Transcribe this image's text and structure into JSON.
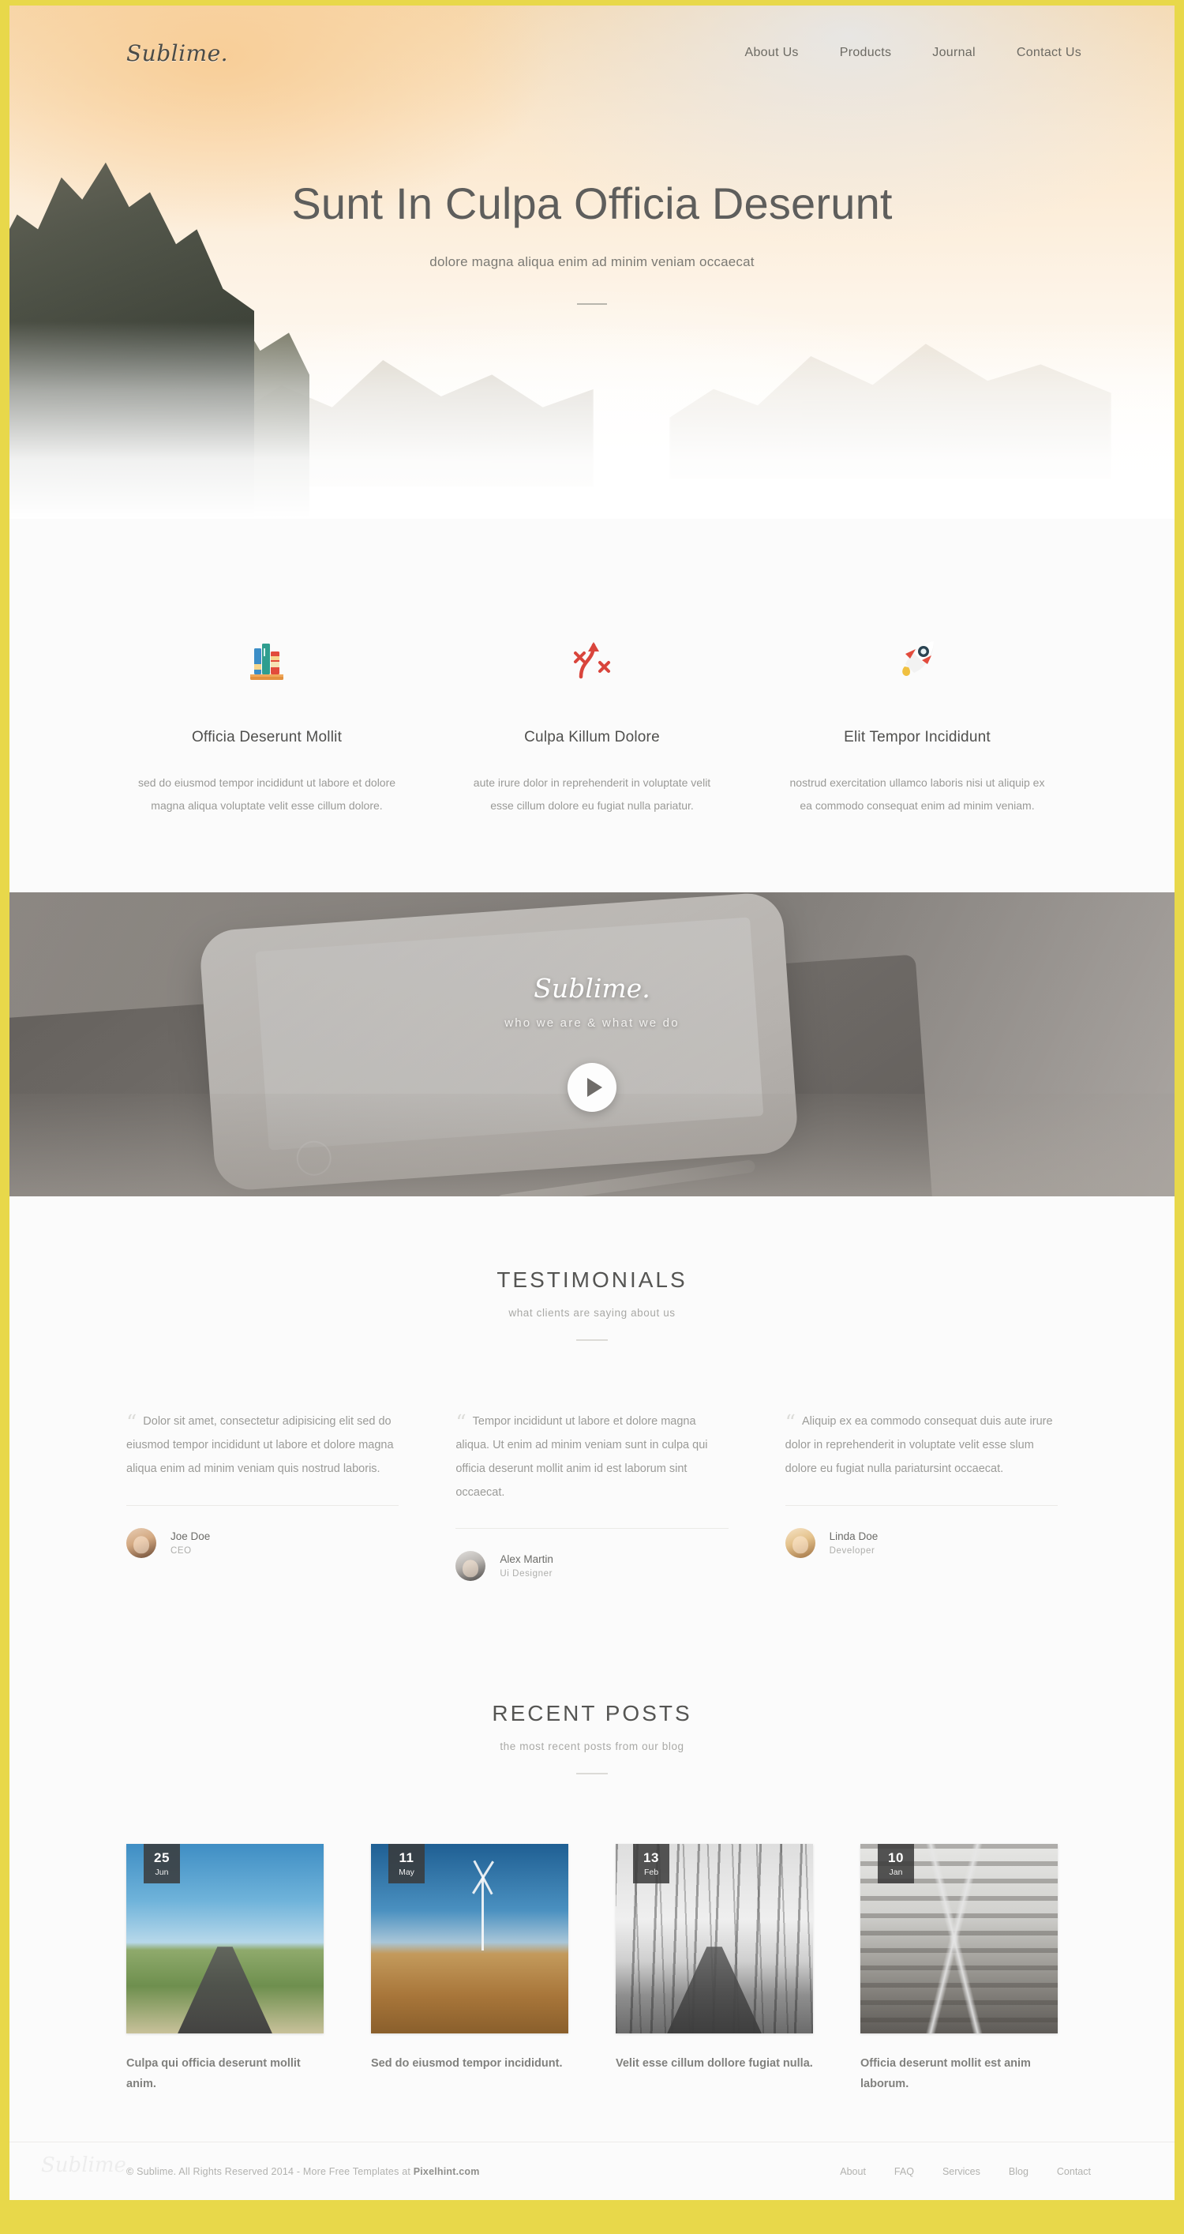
{
  "header": {
    "logo": "Sublime.",
    "nav": [
      {
        "label": "About Us"
      },
      {
        "label": "Products"
      },
      {
        "label": "Journal"
      },
      {
        "label": "Contact Us"
      }
    ]
  },
  "hero": {
    "title": "Sunt In Culpa Officia Deserunt",
    "subtitle": "dolore magna aliqua enim ad minim veniam occaecat"
  },
  "features": [
    {
      "icon": "books-icon",
      "title": "Officia Deserunt Mollit",
      "text": "sed do eiusmod tempor incididunt ut labore et dolore magna aliqua voluptate velit esse cillum dolore."
    },
    {
      "icon": "strategy-arrow-icon",
      "title": "Culpa Killum Dolore",
      "text": "aute irure dolor in reprehenderit in voluptate velit esse cillum dolore eu fugiat nulla pariatur."
    },
    {
      "icon": "rocket-icon",
      "title": "Elit Tempor Incididunt",
      "text": "nostrud exercitation ullamco laboris nisi ut aliquip ex ea commodo consequat enim ad minim veniam."
    }
  ],
  "video": {
    "logo": "Sublime.",
    "tagline": "who we are & what we do",
    "play_icon": "play-icon"
  },
  "testimonials": {
    "title": "TESTIMONIALS",
    "subtitle": "what clients are saying about us",
    "items": [
      {
        "quote": "Dolor sit amet, consectetur adipisicing elit sed do eiusmod tempor incididunt ut labore et dolore magna aliqua enim ad minim veniam quis nostrud laboris.",
        "name": "Joe Doe",
        "role": "CEO"
      },
      {
        "quote": "Tempor incididunt ut labore et dolore magna aliqua. Ut enim ad minim veniam sunt in culpa qui officia deserunt mollit anim id est laborum sint occaecat.",
        "name": "Alex Martin",
        "role": "Ui Designer"
      },
      {
        "quote": "Aliquip ex ea commodo consequat duis aute irure dolor in reprehenderit in voluptate velit esse slum dolore eu fugiat nulla pariatursint occaecat.",
        "name": "Linda Doe",
        "role": "Developer"
      }
    ]
  },
  "posts": {
    "title": "RECENT POSTS",
    "subtitle": "the most recent posts from our blog",
    "items": [
      {
        "day": "25",
        "month": "Jun",
        "title": "Culpa qui officia deserunt mollit anim."
      },
      {
        "day": "11",
        "month": "May",
        "title": "Sed do eiusmod tempor incididunt."
      },
      {
        "day": "13",
        "month": "Feb",
        "title": "Velit esse cillum dollore fugiat nulla."
      },
      {
        "day": "10",
        "month": "Jan",
        "title": "Officia deserunt mollit est anim laborum."
      }
    ]
  },
  "footer": {
    "ghost_logo": "Sublime.",
    "copyright_prefix": "© Sublime. All Rights Reserved 2014 - More Free Templates at ",
    "copyright_brand": "Pixelhint.com",
    "links": [
      {
        "label": "About"
      },
      {
        "label": "FAQ"
      },
      {
        "label": "Services"
      },
      {
        "label": "Blog"
      },
      {
        "label": "Contact"
      }
    ]
  }
}
